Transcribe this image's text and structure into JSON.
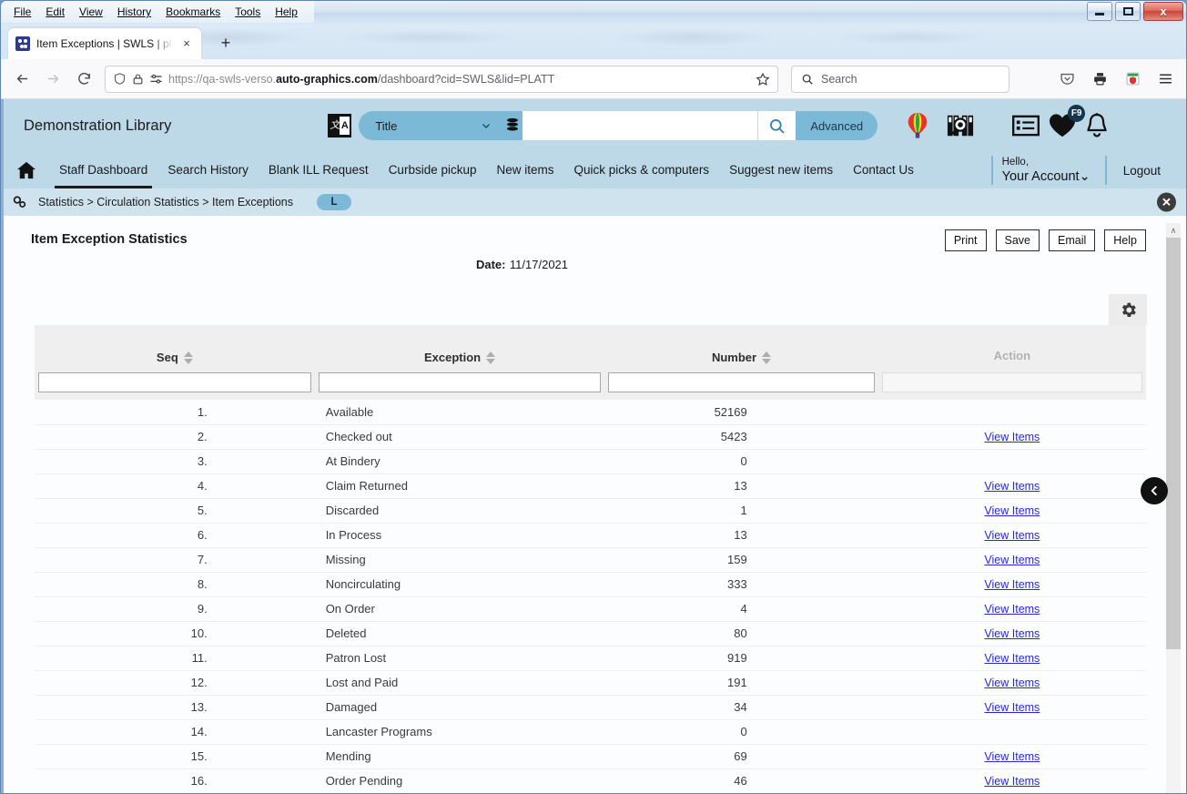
{
  "window": {
    "menus": [
      "File",
      "Edit",
      "View",
      "History",
      "Bookmarks",
      "Tools",
      "Help"
    ],
    "minimize_label": "Minimize",
    "maximize_label": "Maximize",
    "close_label": "x"
  },
  "browser": {
    "tab_title": "Item Exceptions | SWLS | platt | A",
    "tab_close": "×",
    "new_tab": "+",
    "back": "←",
    "forward": "→",
    "reload": "↻",
    "url_prefix": "https://qa-swls-verso.",
    "url_domain": "auto-graphics.com",
    "url_path": "/dashboard?cid=SWLS&lid=PLATT",
    "search_placeholder": "Search",
    "bookmark_star": "☆"
  },
  "app": {
    "library_name": "Demonstration Library",
    "search_scope": "Title",
    "search_value": "",
    "advanced_label": "Advanced",
    "nav": [
      {
        "label": "Staff Dashboard",
        "active": true
      },
      {
        "label": "Search History",
        "active": false
      },
      {
        "label": "Blank ILL Request",
        "active": false
      },
      {
        "label": "Curbside pickup",
        "active": false
      },
      {
        "label": "New items",
        "active": false
      },
      {
        "label": "Quick picks & computers",
        "active": false
      },
      {
        "label": "Suggest new items",
        "active": false
      },
      {
        "label": "Contact Us",
        "active": false
      }
    ],
    "hello_label": "Hello,",
    "account_label": "Your Account",
    "account_caret": "⌄",
    "logout_label": "Logout",
    "favorites_badge": "F9"
  },
  "breadcrumb": {
    "text": "Statistics > Circulation Statistics > Item Exceptions",
    "pill": "L",
    "close": "✕"
  },
  "report": {
    "title": "Item Exception Statistics",
    "date_label": "Date:",
    "date_value": "11/17/2021",
    "buttons": [
      "Print",
      "Save",
      "Email",
      "Help"
    ],
    "settings_icon": "gear-icon"
  },
  "table": {
    "columns": [
      {
        "label": "Seq",
        "sortable": true,
        "disabled": false
      },
      {
        "label": "Exception",
        "sortable": true,
        "disabled": false
      },
      {
        "label": "Number",
        "sortable": true,
        "disabled": false
      },
      {
        "label": "Action",
        "sortable": false,
        "disabled": true
      }
    ],
    "filters": [
      "",
      "",
      "",
      ""
    ],
    "action_link_label": "View Items",
    "rows": [
      {
        "seq": "1.",
        "exception": "Available",
        "number": "52169",
        "action": ""
      },
      {
        "seq": "2.",
        "exception": "Checked out",
        "number": "5423",
        "action": "View Items"
      },
      {
        "seq": "3.",
        "exception": "At Bindery",
        "number": "0",
        "action": ""
      },
      {
        "seq": "4.",
        "exception": "Claim Returned",
        "number": "13",
        "action": "View Items"
      },
      {
        "seq": "5.",
        "exception": "Discarded",
        "number": "1",
        "action": "View Items"
      },
      {
        "seq": "6.",
        "exception": "In Process",
        "number": "13",
        "action": "View Items"
      },
      {
        "seq": "7.",
        "exception": "Missing",
        "number": "159",
        "action": "View Items"
      },
      {
        "seq": "8.",
        "exception": "Noncirculating",
        "number": "333",
        "action": "View Items"
      },
      {
        "seq": "9.",
        "exception": "On Order",
        "number": "4",
        "action": "View Items"
      },
      {
        "seq": "10.",
        "exception": "Deleted",
        "number": "80",
        "action": "View Items"
      },
      {
        "seq": "11.",
        "exception": "Patron Lost",
        "number": "919",
        "action": "View Items"
      },
      {
        "seq": "12.",
        "exception": "Lost and Paid",
        "number": "191",
        "action": "View Items"
      },
      {
        "seq": "13.",
        "exception": "Damaged",
        "number": "34",
        "action": "View Items"
      },
      {
        "seq": "14.",
        "exception": "Lancaster Programs",
        "number": "0",
        "action": ""
      },
      {
        "seq": "15.",
        "exception": "Mending",
        "number": "69",
        "action": "View Items"
      },
      {
        "seq": "16.",
        "exception": "Order Pending",
        "number": "46",
        "action": "View Items"
      }
    ]
  },
  "misc": {
    "back_fab": "‹",
    "scroll_up": "∧"
  },
  "colors": {
    "app_header": "#bdd9e8",
    "accent": "#7cb9d6",
    "link": "#2a29d4",
    "close_button": "#c94436"
  }
}
